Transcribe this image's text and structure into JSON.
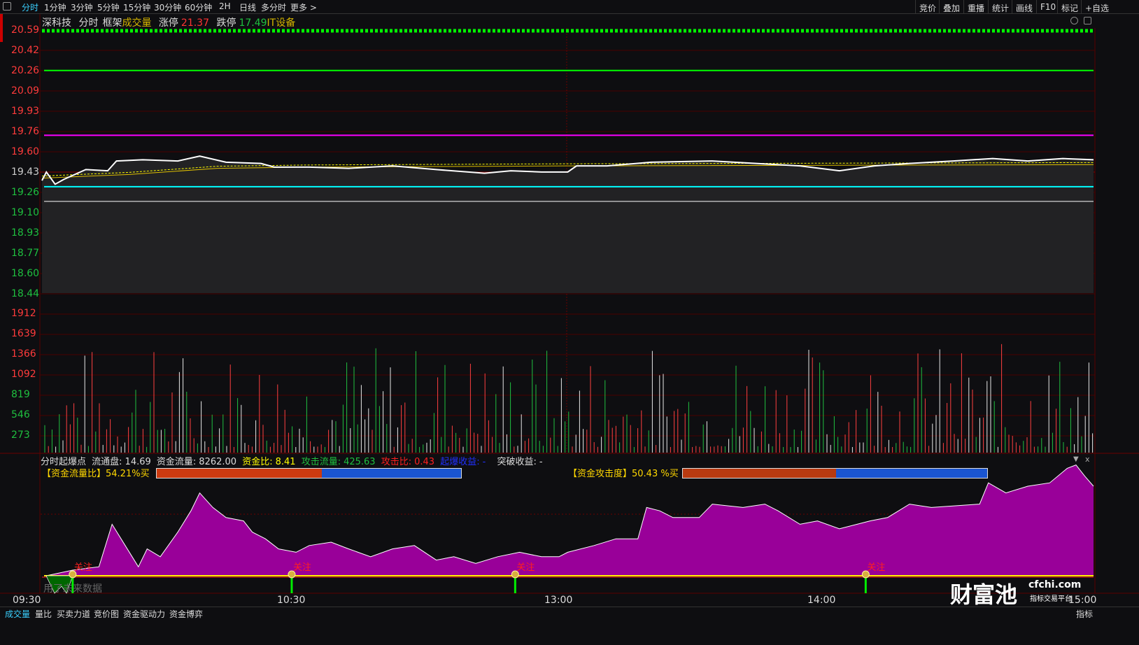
{
  "topbar": {
    "tabs": [
      "分时",
      "1分钟",
      "3分钟",
      "5分钟",
      "15分钟",
      "30分钟",
      "60分钟",
      "2H",
      "日线",
      "多分时",
      "更多 >"
    ],
    "right": [
      "竞价",
      "叠加",
      "重播",
      "统计",
      "画线",
      "F10",
      "标记",
      "+自选"
    ]
  },
  "title": {
    "name": "深科技",
    "mode": "分时",
    "frame": "框架",
    "indicator": "成交量",
    "limit_up_label": "涨停",
    "limit_up": "21.37",
    "limit_down_label": "跌停",
    "limit_down": "17.49",
    "sector": "IT设备"
  },
  "price_axis": [
    "20.59",
    "20.42",
    "20.26",
    "20.09",
    "19.93",
    "19.76",
    "19.60",
    "19.43",
    "19.26",
    "19.10",
    "18.93",
    "18.77",
    "18.60",
    "18.44"
  ],
  "volume_axis": [
    "1912",
    "1639",
    "1366",
    "1092",
    "819",
    "546",
    "273"
  ],
  "time_axis": [
    "09:30",
    "10:30",
    "13:00",
    "14:00",
    "15:00"
  ],
  "indicator": {
    "name": "分时起爆点",
    "float_label": "流通盘:",
    "float_value": "14.69",
    "flow_label": "资金流量:",
    "flow_value": "8262.00",
    "ratio_label": "资金比:",
    "ratio_value": "8.41",
    "attack_flow_label": "攻击流量:",
    "attack_flow_value": "425.63",
    "attack_ratio_label": "攻击比:",
    "attack_ratio_value": "0.43",
    "burst_label": "起爆收益:",
    "burst_value": "-",
    "break_label": "突破收益:",
    "break_value": "-",
    "flow_ratio_text": "【资金流量比】54.21%买",
    "flow_ratio": 54.21,
    "attack_text": "【资金攻击度】50.43 %买",
    "attack": 50.43,
    "marker_label": "关注",
    "future_text": "用了未来数据"
  },
  "bottom_tabs": [
    "成交量",
    "量比",
    "买卖力道",
    "竞价图",
    "资金驱动力",
    "资金博弈"
  ],
  "bottom_right": "指标",
  "logo": {
    "name": "财富池",
    "site": "cfchi.com",
    "slogan": "指标交易平台"
  },
  "colors": {
    "up": "#ff3333",
    "down": "#00cc33",
    "purple": "#990099",
    "green_line": "#00ff00",
    "magenta_line": "#ff00ff",
    "cyan_line": "#00ffff"
  },
  "chart_data": {
    "type": "line",
    "price": [
      [
        0,
        19.36
      ],
      [
        1,
        19.43
      ],
      [
        3,
        19.33
      ],
      [
        5,
        19.37
      ],
      [
        10,
        19.45
      ],
      [
        15,
        19.44
      ],
      [
        17,
        19.52
      ],
      [
        23,
        19.53
      ],
      [
        31,
        19.52
      ],
      [
        36,
        19.56
      ],
      [
        42,
        19.51
      ],
      [
        50,
        19.5
      ],
      [
        53,
        19.47
      ],
      [
        61,
        19.47
      ],
      [
        70,
        19.46
      ],
      [
        80,
        19.48
      ],
      [
        90,
        19.45
      ],
      [
        101,
        19.42
      ],
      [
        107,
        19.44
      ],
      [
        114,
        19.43
      ],
      [
        120,
        19.43
      ],
      [
        122,
        19.48
      ],
      [
        129,
        19.48
      ],
      [
        139,
        19.51
      ],
      [
        153,
        19.52
      ],
      [
        163,
        19.5
      ],
      [
        173,
        19.48
      ],
      [
        182,
        19.44
      ],
      [
        190,
        19.48
      ],
      [
        198,
        19.5
      ],
      [
        208,
        19.52
      ],
      [
        217,
        19.54
      ],
      [
        225,
        19.52
      ],
      [
        233,
        19.54
      ],
      [
        240,
        19.53
      ]
    ],
    "avg": [
      [
        0,
        19.38
      ],
      [
        20,
        19.41
      ],
      [
        40,
        19.46
      ],
      [
        60,
        19.47
      ],
      [
        120,
        19.48
      ],
      [
        240,
        19.49
      ]
    ],
    "levels": {
      "green": 20.26,
      "magenta": 19.73,
      "cyan": 19.31,
      "white": 19.19
    },
    "ylim": [
      18.44,
      20.59
    ],
    "attack_area": [
      [
        1,
        0
      ],
      [
        7,
        5
      ],
      [
        13,
        8
      ],
      [
        16,
        46
      ],
      [
        19,
        27
      ],
      [
        22,
        8
      ],
      [
        24,
        24
      ],
      [
        27,
        17
      ],
      [
        31,
        39
      ],
      [
        34,
        58
      ],
      [
        36,
        74
      ],
      [
        39,
        61
      ],
      [
        42,
        52
      ],
      [
        46,
        49
      ],
      [
        48,
        39
      ],
      [
        51,
        33
      ],
      [
        54,
        24
      ],
      [
        58,
        21
      ],
      [
        61,
        27
      ],
      [
        66,
        30
      ],
      [
        70,
        24
      ],
      [
        75,
        17
      ],
      [
        80,
        24
      ],
      [
        85,
        27
      ],
      [
        90,
        14
      ],
      [
        94,
        17
      ],
      [
        99,
        11
      ],
      [
        104,
        17
      ],
      [
        109,
        21
      ],
      [
        114,
        17
      ],
      [
        118,
        17
      ],
      [
        120,
        21
      ],
      [
        126,
        27
      ],
      [
        131,
        33
      ],
      [
        136,
        33
      ],
      [
        138,
        61
      ],
      [
        141,
        58
      ],
      [
        144,
        52
      ],
      [
        150,
        52
      ],
      [
        153,
        64
      ],
      [
        160,
        61
      ],
      [
        165,
        64
      ],
      [
        168,
        58
      ],
      [
        173,
        46
      ],
      [
        177,
        49
      ],
      [
        182,
        42
      ],
      [
        189,
        49
      ],
      [
        193,
        52
      ],
      [
        198,
        64
      ],
      [
        203,
        61
      ],
      [
        214,
        64
      ],
      [
        216,
        83
      ],
      [
        220,
        74
      ],
      [
        225,
        80
      ],
      [
        230,
        83
      ],
      [
        234,
        96
      ],
      [
        236,
        99
      ],
      [
        238,
        89
      ],
      [
        240,
        80
      ]
    ],
    "markers": [
      7,
      57,
      108,
      188
    ]
  }
}
